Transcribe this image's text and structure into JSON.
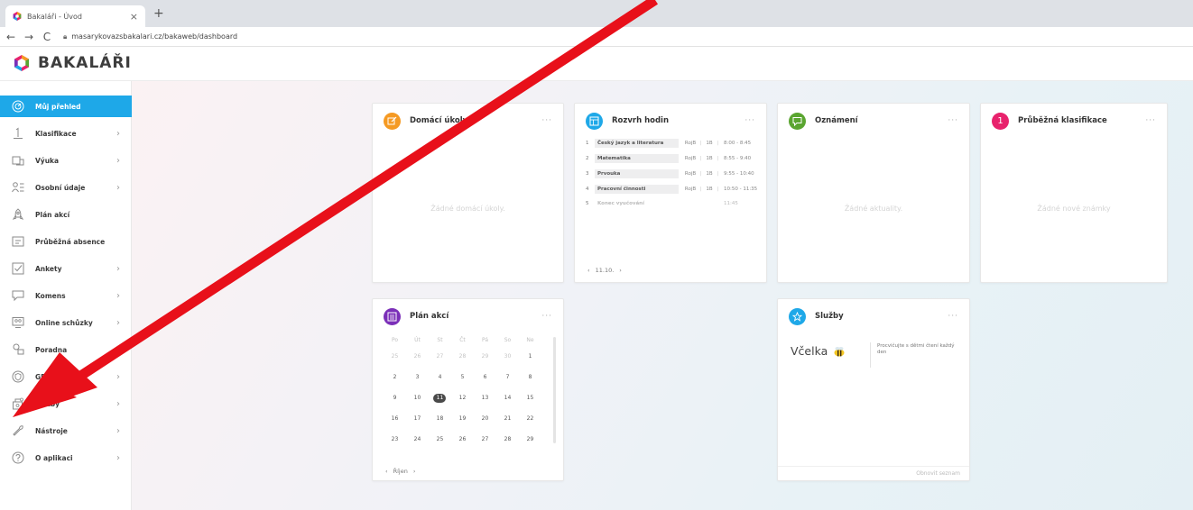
{
  "browser": {
    "tab_title": "Bakaláři - Úvod",
    "tab_close": "×",
    "new_tab": "+",
    "back": "←",
    "forward": "→",
    "reload": "C",
    "url": "masarykovazsbakalari.cz/bakaweb/dashboard"
  },
  "app": {
    "logo_text": "BAKALÁŘI"
  },
  "sidebar": {
    "items": [
      {
        "label": "Můj přehled",
        "icon": "gauge-icon",
        "chevron": ""
      },
      {
        "label": "Klasifikace",
        "icon": "grade-one-icon",
        "chevron": "›"
      },
      {
        "label": "Výuka",
        "icon": "book-icon",
        "chevron": "›"
      },
      {
        "label": "Osobní údaje",
        "icon": "person-list-icon",
        "chevron": "›"
      },
      {
        "label": "Plán akcí",
        "icon": "rocket-icon",
        "chevron": ""
      },
      {
        "label": "Průběžná absence",
        "icon": "absence-icon",
        "chevron": ""
      },
      {
        "label": "Ankety",
        "icon": "checkbox-icon",
        "chevron": "›"
      },
      {
        "label": "Komens",
        "icon": "message-icon",
        "chevron": "›"
      },
      {
        "label": "Online schůzky",
        "icon": "monitor-icon",
        "chevron": "›"
      },
      {
        "label": "Poradna",
        "icon": "chat-icon",
        "chevron": ""
      },
      {
        "label": "GDPR",
        "icon": "shield-icon",
        "chevron": "›"
      },
      {
        "label": "Platby",
        "icon": "payment-icon",
        "chevron": "›"
      },
      {
        "label": "Nástroje",
        "icon": "wrench-icon",
        "chevron": "›"
      },
      {
        "label": "O aplikaci",
        "icon": "question-icon",
        "chevron": "›"
      }
    ]
  },
  "cards": {
    "homework": {
      "title": "Domácí úkoly",
      "empty": "Žádné domácí úkoly.",
      "more": "···",
      "color": "#f59a23"
    },
    "schedule": {
      "title": "Rozvrh hodin",
      "more": "···",
      "color": "#1ea8e8",
      "rows": [
        {
          "num": "1",
          "subject": "Český jazyk a literatura",
          "room": "RojB",
          "cls": "1B",
          "time": "8:00 - 8:45"
        },
        {
          "num": "2",
          "subject": "Matematika",
          "room": "RojB",
          "cls": "1B",
          "time": "8:55 - 9:40"
        },
        {
          "num": "3",
          "subject": "Prvouka",
          "room": "RojB",
          "cls": "1B",
          "time": "9:55 - 10:40"
        },
        {
          "num": "4",
          "subject": "Pracovní činnosti",
          "room": "RojB",
          "cls": "1B",
          "time": "10:50 - 11:35"
        },
        {
          "num": "5",
          "subject": "Konec vyučování",
          "room": "",
          "cls": "",
          "time": "11:45"
        }
      ],
      "date": "11.10."
    },
    "announcements": {
      "title": "Oznámení",
      "empty": "Žádné aktuality.",
      "more": "···",
      "color": "#5aa530"
    },
    "grades": {
      "title": "Průběžná klasifikace",
      "empty": "Žádné nové známky",
      "more": "···",
      "color": "#e8226c",
      "icon_text": "1"
    },
    "events": {
      "title": "Plán akcí",
      "more": "···",
      "color": "#7b2fb8",
      "weekdays": [
        "Po",
        "Út",
        "St",
        "Čt",
        "Pá",
        "So",
        "Ne"
      ],
      "weeks": [
        [
          "25",
          "26",
          "27",
          "28",
          "29",
          "30",
          "1"
        ],
        [
          "2",
          "3",
          "4",
          "5",
          "6",
          "7",
          "8"
        ],
        [
          "9",
          "10",
          "11",
          "12",
          "13",
          "14",
          "15"
        ],
        [
          "16",
          "17",
          "18",
          "19",
          "20",
          "21",
          "22"
        ],
        [
          "23",
          "24",
          "25",
          "26",
          "27",
          "28",
          "29"
        ]
      ],
      "today": "11",
      "month": "Říjen"
    },
    "services": {
      "title": "Služby",
      "more": "···",
      "color": "#1ea8e8",
      "service_name": "Včelka",
      "service_desc": "Procvičujte s dětmi čtení každý den",
      "refresh": "Obnovit seznam"
    }
  },
  "colors": {
    "accent": "#1ea8e8",
    "annotation_arrow": "#e8101a"
  }
}
